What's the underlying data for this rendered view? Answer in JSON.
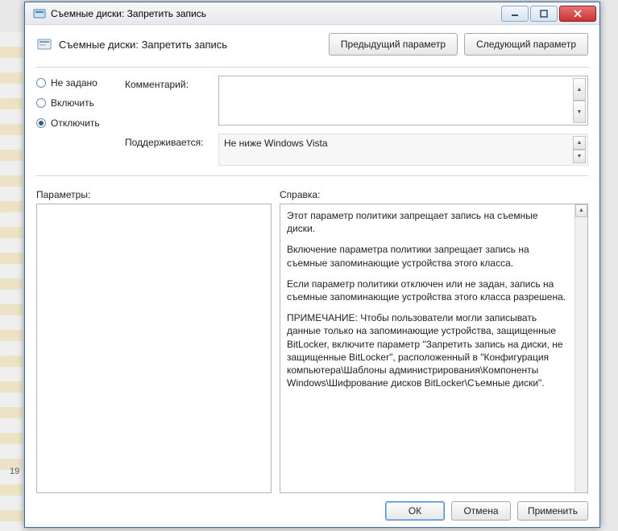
{
  "titlebar": {
    "title": "Съемные диски: Запретить запись"
  },
  "header": {
    "title": "Съемные диски: Запретить запись",
    "prev_label": "Предыдущий параметр",
    "next_label": "Следующий параметр"
  },
  "radios": {
    "not_configured": "Не задано",
    "enabled": "Включить",
    "disabled": "Отключить",
    "selected": "disabled"
  },
  "fields": {
    "comment_label": "Комментарий:",
    "comment_value": "",
    "supported_label": "Поддерживается:",
    "supported_value": "Не ниже Windows Vista"
  },
  "lower": {
    "options_label": "Параметры:",
    "help_label": "Справка:",
    "help_paragraphs": [
      "Этот параметр политики запрещает запись на съемные диски.",
      "Включение параметра политики запрещает запись на съемные запоминающие устройства этого класса.",
      "Если параметр политики отключен или не задан, запись на съемные запоминающие устройства этого класса разрешена.",
      "ПРИМЕЧАНИЕ: Чтобы пользователи могли записывать данные только на запоминающие устройства, защищенные BitLocker, включите параметр \"Запретить запись на диски, не защищенные BitLocker\", расположенный в \"Конфигурация компьютера\\Шаблоны администрирования\\Компоненты Windows\\Шифрование дисков BitLocker\\Съемные диски\"."
    ]
  },
  "footer": {
    "ok": "ОК",
    "cancel": "Отмена",
    "apply": "Применить"
  },
  "bg": {
    "status": "19"
  }
}
